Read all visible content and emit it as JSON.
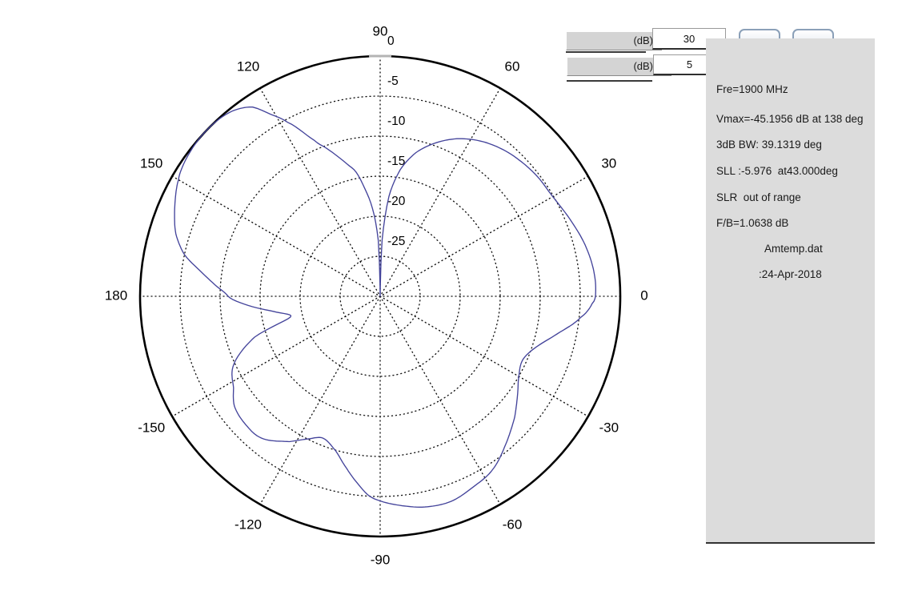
{
  "controls": {
    "range_row": {
      "label": "(dB)",
      "value": "30"
    },
    "step_row": {
      "label": "(dB)",
      "value": "5"
    },
    "buttons": [
      {
        "name": "pushbutton-1",
        "label": ""
      },
      {
        "name": "pushbutton-2",
        "label": ""
      }
    ]
  },
  "panel": {
    "lines": [
      "Fre=1900 MHz",
      "Vmax=-45.1956 dB at 138 deg",
      "3dB BW: 39.1319 deg",
      "SLL :-5.976  at43.000deg",
      "SLR  out of range",
      "F/B=1.0638 dB"
    ],
    "file_name": "Amtemp.dat",
    "file_date": ":24-Apr-2018"
  },
  "chart_data": {
    "type": "line",
    "subtype": "polar",
    "title": "",
    "grid": true,
    "angle_unit": "deg",
    "angle_ticks": [
      0,
      30,
      60,
      90,
      120,
      150,
      180,
      -150,
      -120,
      -90,
      -60,
      -30
    ],
    "radial_axis": {
      "unit": "dB",
      "ticks": [
        0,
        -5,
        -10,
        -15,
        -20,
        -25
      ],
      "min": -30,
      "max": 0
    },
    "colors": {
      "curve": "#44449b",
      "grid": "#000000",
      "outer_circle": "#000000",
      "top_tick": "#b4b4b4"
    },
    "series": [
      {
        "name": "radiation-pattern",
        "points_deg_db": [
          [
            -180,
            -11.0
          ],
          [
            -176,
            -13.5
          ],
          [
            -172,
            -16.5
          ],
          [
            -167,
            -18.5
          ],
          [
            -162,
            -13.5
          ],
          [
            -155,
            -9.8
          ],
          [
            -148,
            -8.4
          ],
          [
            -143,
            -7.2
          ],
          [
            -137,
            -6.8
          ],
          [
            -130,
            -6.9
          ],
          [
            -122,
            -8.6
          ],
          [
            -117,
            -10.0
          ],
          [
            -112,
            -10.9
          ],
          [
            -106,
            -9.9
          ],
          [
            -101,
            -8.1
          ],
          [
            -97,
            -6.5
          ],
          [
            -93,
            -5.0
          ],
          [
            -89,
            -4.3
          ],
          [
            -84,
            -3.7
          ],
          [
            -78,
            -3.1
          ],
          [
            -71,
            -2.9
          ],
          [
            -64,
            -3.5
          ],
          [
            -57,
            -4.2
          ],
          [
            -49,
            -5.9
          ],
          [
            -42,
            -7.4
          ],
          [
            -36,
            -8.8
          ],
          [
            -30,
            -10.0
          ],
          [
            -24,
            -10.5
          ],
          [
            -18,
            -9.5
          ],
          [
            -12,
            -7.4
          ],
          [
            -6,
            -4.8
          ],
          [
            -2,
            -3.5
          ],
          [
            0,
            -3.1
          ],
          [
            6,
            -3.1
          ],
          [
            14,
            -3.6
          ],
          [
            22,
            -4.4
          ],
          [
            30,
            -5.1
          ],
          [
            37,
            -5.3
          ],
          [
            43,
            -5.6
          ],
          [
            50,
            -6.1
          ],
          [
            57,
            -6.9
          ],
          [
            64,
            -8.1
          ],
          [
            70,
            -9.6
          ],
          [
            76,
            -11.5
          ],
          [
            81,
            -14.0
          ],
          [
            85,
            -17.5
          ],
          [
            88,
            -23.0
          ],
          [
            90,
            -30.0
          ],
          [
            92,
            -23.0
          ],
          [
            95,
            -19.0
          ],
          [
            98,
            -16.5
          ],
          [
            101,
            -14.2
          ],
          [
            104,
            -13.0
          ],
          [
            107,
            -11.7
          ],
          [
            110,
            -10.3
          ],
          [
            113,
            -8.8
          ],
          [
            118,
            -5.4
          ],
          [
            121,
            -3.5
          ],
          [
            124,
            -1.5
          ],
          [
            128,
            -0.5
          ],
          [
            132,
            -0.1
          ],
          [
            137,
            0.0
          ],
          [
            141,
            -0.1
          ],
          [
            146,
            -0.4
          ],
          [
            150,
            -0.9
          ],
          [
            157,
            -2.1
          ],
          [
            163,
            -3.3
          ],
          [
            168,
            -5.0
          ],
          [
            172,
            -7.3
          ],
          [
            176,
            -9.3
          ],
          [
            180,
            -11.0
          ]
        ]
      }
    ]
  }
}
